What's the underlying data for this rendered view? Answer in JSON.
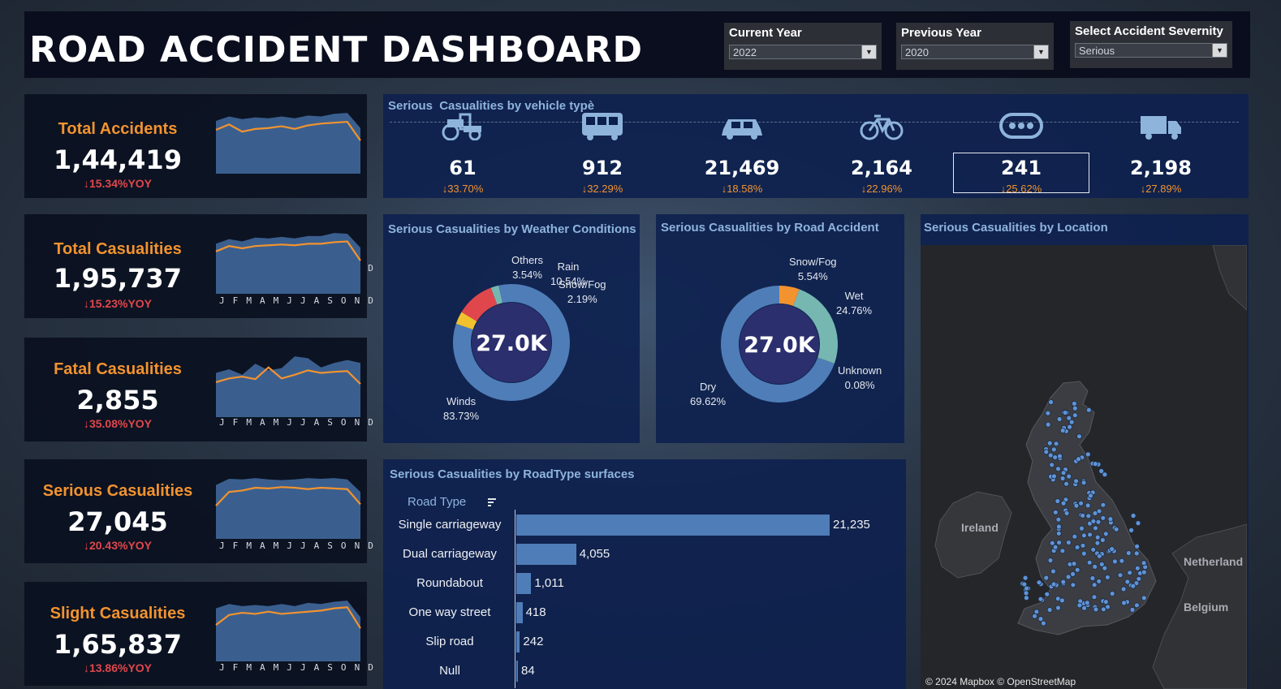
{
  "header": {
    "title": "ROAD ACCIDENT DASHBOARD"
  },
  "filters": [
    {
      "label": "Current Year",
      "value": "2022"
    },
    {
      "label": "Previous Year",
      "value": "2020"
    },
    {
      "label": "Select Accident Severnity",
      "value": "Serious"
    }
  ],
  "kpis": [
    {
      "label": "Total Accidents",
      "value": "1,44,419",
      "yoy": "↓15.34%YOY"
    },
    {
      "label": "Total Casualities",
      "value": "1,95,737",
      "yoy": "↓15.23%YOY"
    },
    {
      "label": "Fatal Casualities",
      "value": "2,855",
      "yoy": "↓35.08%YOY"
    },
    {
      "label": "Serious Casualities",
      "value": "27,045",
      "yoy": "↓20.43%YOY"
    },
    {
      "label": "Slight Casualities",
      "value": "1,65,837",
      "yoy": "↓13.86%YOY"
    }
  ],
  "months": [
    "J",
    "F",
    "M",
    "A",
    "M",
    "J",
    "J",
    "A",
    "S",
    "O",
    "N",
    "D"
  ],
  "vehicles": {
    "title_a": "Serious",
    "title_b": "Casualities by vehicle typè",
    "items": [
      {
        "icon": "tractor-icon",
        "value": "61",
        "pct": "↓33.70%",
        "selected": false
      },
      {
        "icon": "bus-icon",
        "value": "912",
        "pct": "↓32.29%",
        "selected": false
      },
      {
        "icon": "car-icon",
        "value": "21,469",
        "pct": "↓18.58%",
        "selected": false
      },
      {
        "icon": "bicycle-icon",
        "value": "2,164",
        "pct": "↓22.96%",
        "selected": false
      },
      {
        "icon": "other-vehicle-icon",
        "value": "241",
        "pct": "↓25.62%",
        "selected": true
      },
      {
        "icon": "truck-icon",
        "value": "2,198",
        "pct": "↓27.89%",
        "selected": false
      }
    ]
  },
  "weather": {
    "title": "Serious Casualities by Weather Conditions",
    "center": "27.0K",
    "labels": {
      "others": "Others",
      "others_pct": "3.54%",
      "rain": "Rain",
      "rain_pct": "10.54%",
      "snow": "Snow/Fog",
      "snow_pct": "2.19%",
      "winds": "Winds",
      "winds_pct": "83.73%"
    }
  },
  "surface": {
    "title": "Serious Casualities by Road Accident",
    "center": "27.0K",
    "labels": {
      "snow": "Snow/Fog",
      "snow_pct": "5.54%",
      "wet": "Wet",
      "wet_pct": "24.76%",
      "unknown": "Unknown",
      "unknown_pct": "0.08%",
      "dry": "Dry",
      "dry_pct": "69.62%"
    }
  },
  "location": {
    "title": "Serious Casualities by Location",
    "labels": {
      "ireland": "Ireland",
      "netherland": "Netherland",
      "belgium": "Belgium"
    },
    "credit": "© 2024 Mapbox © OpenStreetMap"
  },
  "road_type": {
    "title": "Serious Casualities by RoadType surfaces",
    "header": "Road Type"
  },
  "colors": {
    "accent_orange": "#f2932f",
    "negative_red": "#e0474c",
    "area_blue": "#3a5f8f",
    "donut_blue": "#4f7db8",
    "donut_center": "#2c2f6e",
    "rain_red": "#e0474c",
    "others_yellow": "#f2c12e",
    "teal": "#76b7b2"
  },
  "chart_data": [
    {
      "type": "area",
      "name": "Total Accidents trend",
      "categories": [
        "J",
        "F",
        "M",
        "A",
        "M",
        "J",
        "J",
        "A",
        "S",
        "O",
        "N",
        "D"
      ],
      "values": [
        12000,
        12600,
        11800,
        12100,
        12200,
        12400,
        12100,
        12500,
        12700,
        12800,
        12900,
        10800
      ],
      "area_values": [
        13000,
        13500,
        13200,
        13400,
        13300,
        13500,
        13300,
        13600,
        13500,
        13800,
        13900,
        12200
      ]
    },
    {
      "type": "area",
      "name": "Total Casualities trend",
      "categories": [
        "J",
        "F",
        "M",
        "A",
        "M",
        "J",
        "J",
        "A",
        "S",
        "O",
        "N",
        "D"
      ],
      "values": [
        16000,
        16700,
        16400,
        16700,
        16800,
        16900,
        16800,
        17000,
        17000,
        17200,
        17300,
        14800
      ],
      "area_values": [
        17000,
        17600,
        17300,
        17800,
        17700,
        17900,
        17700,
        18000,
        18000,
        18400,
        18300,
        16500
      ]
    },
    {
      "type": "area",
      "name": "Fatal Casualities trend",
      "categories": [
        "J",
        "F",
        "M",
        "A",
        "M",
        "J",
        "J",
        "A",
        "S",
        "O",
        "N",
        "D"
      ],
      "values": [
        230,
        240,
        245,
        238,
        270,
        240,
        250,
        262,
        255,
        258,
        260,
        225
      ],
      "area_values": [
        255,
        265,
        250,
        280,
        262,
        268,
        300,
        295,
        270,
        282,
        290,
        282
      ]
    },
    {
      "type": "area",
      "name": "Serious Casualities trend",
      "categories": [
        "J",
        "F",
        "M",
        "A",
        "M",
        "J",
        "J",
        "A",
        "S",
        "O",
        "N",
        "D"
      ],
      "values": [
        2100,
        2300,
        2320,
        2360,
        2350,
        2370,
        2360,
        2340,
        2360,
        2350,
        2340,
        2120
      ],
      "area_values": [
        2400,
        2490,
        2480,
        2500,
        2480,
        2470,
        2480,
        2500,
        2490,
        2500,
        2480,
        2300
      ]
    },
    {
      "type": "area",
      "name": "Slight Casualities trend",
      "categories": [
        "J",
        "F",
        "M",
        "A",
        "M",
        "J",
        "J",
        "A",
        "S",
        "O",
        "N",
        "D"
      ],
      "values": [
        13300,
        14200,
        14400,
        14300,
        14500,
        14300,
        14400,
        14500,
        14600,
        14800,
        14900,
        13000
      ],
      "area_values": [
        14800,
        15200,
        15000,
        15100,
        15000,
        15200,
        15000,
        15300,
        15200,
        15400,
        15500,
        14000
      ]
    },
    {
      "type": "pie",
      "name": "Weather Conditions",
      "labels": [
        "Winds",
        "Others",
        "Rain",
        "Snow/Fog"
      ],
      "values": [
        83.73,
        3.54,
        10.54,
        2.19
      ]
    },
    {
      "type": "pie",
      "name": "Road Surface",
      "labels": [
        "Dry",
        "Snow/Fog",
        "Wet",
        "Unknown"
      ],
      "values": [
        69.62,
        5.54,
        24.76,
        0.08
      ]
    },
    {
      "type": "bar",
      "name": "Road Type",
      "categories": [
        "Single carriageway",
        "Dual carriageway",
        "Roundabout",
        "One way street",
        "Slip road",
        "Null"
      ],
      "values": [
        21235,
        4055,
        1011,
        418,
        242,
        84
      ],
      "value_labels": [
        "21,235",
        "4,055",
        "1,011",
        "418",
        "242",
        "84"
      ]
    }
  ]
}
